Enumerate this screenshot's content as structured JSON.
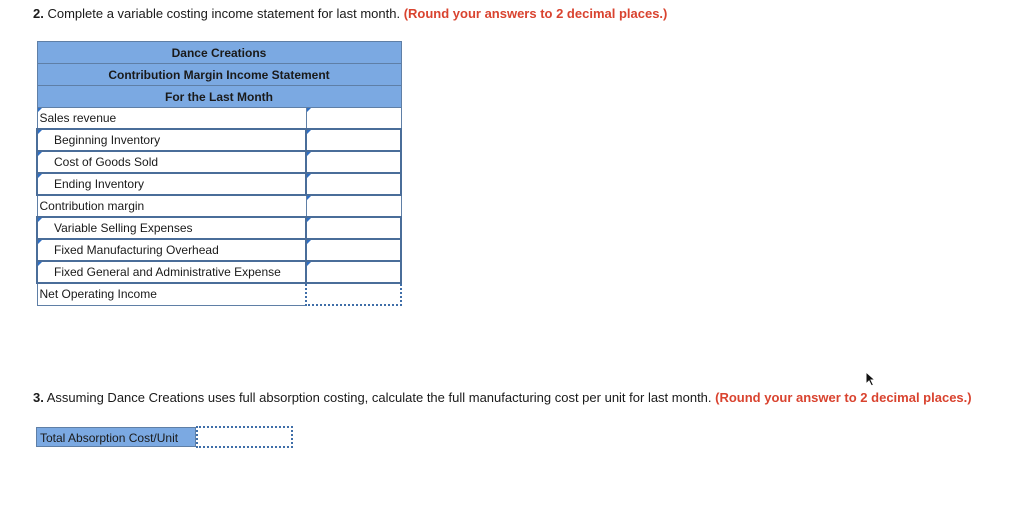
{
  "question2": {
    "number": "2.",
    "text": " Complete a variable costing income statement for last month. ",
    "instruction": "(Round your answers to 2 decimal places.)"
  },
  "statement": {
    "company": "Dance Creations",
    "title": "Contribution Margin Income Statement",
    "period": "For the Last Month",
    "rows": [
      {
        "label": "Sales revenue",
        "indent": false,
        "value": ""
      },
      {
        "label": "Beginning Inventory",
        "indent": true,
        "value": ""
      },
      {
        "label": "Cost of Goods Sold",
        "indent": true,
        "value": ""
      },
      {
        "label": "Ending Inventory",
        "indent": true,
        "value": ""
      },
      {
        "label": "Contribution margin",
        "indent": false,
        "value": ""
      },
      {
        "label": "Variable Selling Expenses",
        "indent": true,
        "value": ""
      },
      {
        "label": "Fixed Manufacturing Overhead",
        "indent": true,
        "value": ""
      },
      {
        "label": "Fixed General and Administrative Expense",
        "indent": true,
        "value": ""
      },
      {
        "label": "Net Operating Income",
        "indent": false,
        "value": ""
      }
    ]
  },
  "question3": {
    "number": "3.",
    "text": " Assuming Dance Creations uses full absorption costing, calculate the full manufacturing cost per unit for last month. ",
    "instruction": "(Round your answer to 2 decimal places.)"
  },
  "absorption": {
    "label": "Total Absorption Cost/Unit",
    "value": ""
  },
  "icons": {
    "cursor": "mouse-pointer-icon",
    "dropdown_flag": "dropdown-flag-icon"
  }
}
